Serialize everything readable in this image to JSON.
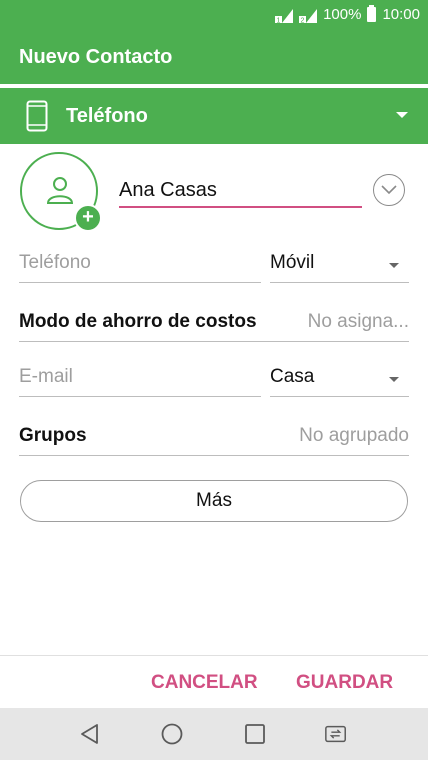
{
  "status_bar": {
    "battery_text": "100%",
    "time": "10:00",
    "sim1_label": "1",
    "sim2_label": "2"
  },
  "app_bar": {
    "title": "Nuevo Contacto"
  },
  "account": {
    "label": "Teléfono",
    "icon": "phone-icon"
  },
  "contact": {
    "name": "Ana Casas",
    "avatar_icon": "person-icon"
  },
  "phone": {
    "placeholder": "Teléfono",
    "type": "Móvil"
  },
  "cost_saving": {
    "label": "Modo de ahorro de costos",
    "value": "No asigna..."
  },
  "email": {
    "placeholder": "E-mail",
    "type": "Casa"
  },
  "groups": {
    "label": "Grupos",
    "value": "No agrupado"
  },
  "more_button": "Más",
  "actions": {
    "cancel": "CANCELAR",
    "save": "GUARDAR"
  },
  "colors": {
    "primary": "#4caf50",
    "accent": "#d14f82"
  }
}
